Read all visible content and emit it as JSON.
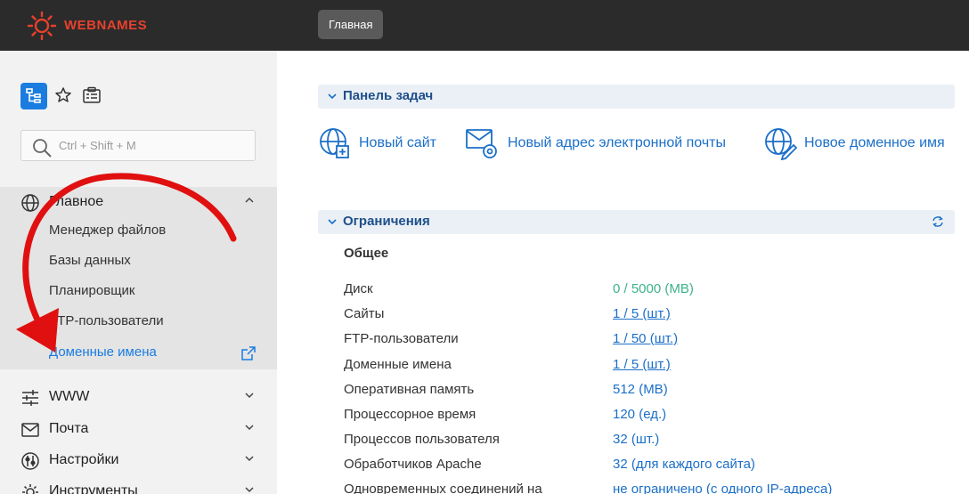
{
  "header": {
    "logo_text": "WEBNAMES",
    "home_pill": "Главная"
  },
  "sidebar": {
    "search_placeholder": "Ctrl + Shift + M",
    "main_group": {
      "label": "Главное",
      "items": [
        "Менеджер файлов",
        "Базы данных",
        "Планировщик",
        "FTP-пользователи",
        "Доменные имена"
      ],
      "active_item": "Доменные имена"
    },
    "groups": [
      {
        "label": "WWW",
        "icon": "sliders-icon"
      },
      {
        "label": "Почта",
        "icon": "mail-icon"
      },
      {
        "label": "Настройки",
        "icon": "settings-icon"
      },
      {
        "label": "Инструменты",
        "icon": "tools-icon"
      }
    ]
  },
  "tasks_panel": {
    "title": "Панель задач",
    "tasks": [
      {
        "label": "Новый сайт",
        "icon": "globe-plus-icon"
      },
      {
        "label": "Новый адрес электронной почты",
        "icon": "mail-gear-icon"
      },
      {
        "label": "Новое доменное имя",
        "icon": "globe-pen-icon"
      }
    ]
  },
  "limits_panel": {
    "title": "Ограничения",
    "section": "Общее",
    "rows": [
      {
        "key": "Диск",
        "value": "0 / 5000 (MB)",
        "style": "green"
      },
      {
        "key": "Сайты",
        "value": "1 / 5 (шт.)",
        "style": "link"
      },
      {
        "key": "FTP-пользователи",
        "value": "1 / 50 (шт.)",
        "style": "link"
      },
      {
        "key": "Доменные имена",
        "value": "1 / 5 (шт.)",
        "style": "link"
      },
      {
        "key": "Оперативная память",
        "value": "512 (MB)",
        "style": "blue"
      },
      {
        "key": "Процессорное время",
        "value": "120 (ед.)",
        "style": "blue"
      },
      {
        "key": "Процессов пользователя",
        "value": "32 (шт.)",
        "style": "blue"
      },
      {
        "key": "Обработчиков Apache",
        "value": "32 (для каждого сайта)",
        "style": "blue"
      },
      {
        "key": "Одновременных соединений на",
        "value": "не ограничено (с одного IP-адреса)",
        "style": "link"
      }
    ]
  },
  "colors": {
    "topbar": "#2b2b2b",
    "brand": "#e8412c",
    "accent": "#1b7ce0",
    "annotation": "#e01010"
  }
}
